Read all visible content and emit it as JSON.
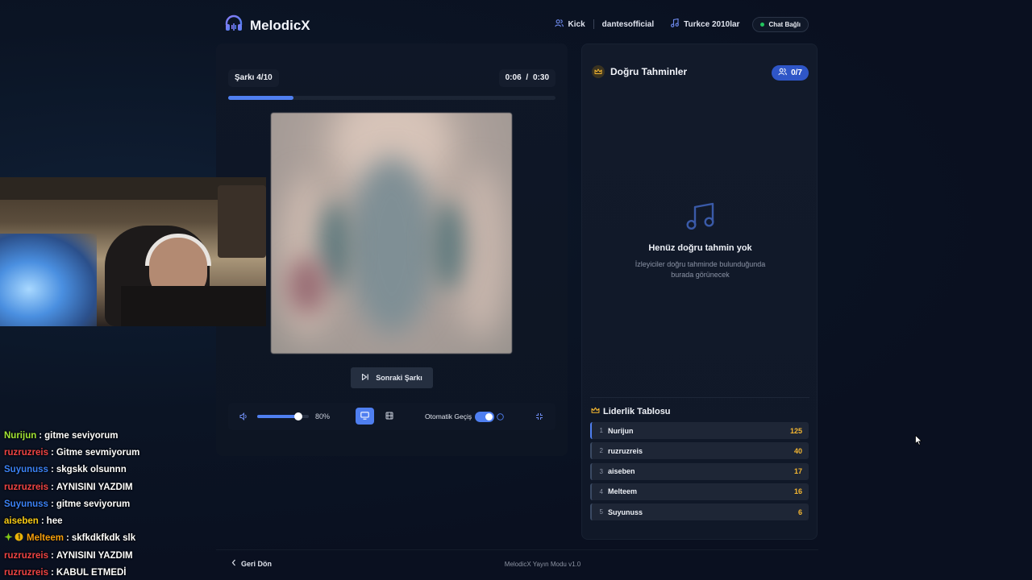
{
  "app": {
    "name": "MelodicX",
    "version_text": "MelodicX Yayın Modu v1.0",
    "colors": {
      "accent": "#4f7ff0",
      "success": "#22c55e",
      "gold": "#f5b731"
    }
  },
  "header": {
    "platform": "Kick",
    "channel": "dantesofficial",
    "playlist": "Turkce 2010lar",
    "chat_status": "Chat Bağlı"
  },
  "player": {
    "song_counter": "Şarkı 4/10",
    "time_current": "0:06",
    "time_separator": "/",
    "time_total": "0:30",
    "progress": 0.2,
    "next_label": "Sonraki Şarkı",
    "volume_label": "80%",
    "volume": 0.8,
    "auto_label": "Otomatik Geçiş",
    "auto_enabled": true
  },
  "guesses": {
    "title": "Doğru Tahminler",
    "count": "0/7",
    "empty_title": "Henüz doğru tahmin yok",
    "empty_desc_line1": "İzleyiciler doğru tahminde bulunduğunda",
    "empty_desc_line2": "burada görünecek"
  },
  "leaderboard": {
    "title": "Liderlik Tablosu",
    "rows": [
      {
        "rank": "1",
        "name": "Nurijun",
        "score": "125"
      },
      {
        "rank": "2",
        "name": "ruzruzreis",
        "score": "40"
      },
      {
        "rank": "3",
        "name": "aiseben",
        "score": "17"
      },
      {
        "rank": "4",
        "name": "Melteem",
        "score": "16"
      },
      {
        "rank": "5",
        "name": "Suyunuss",
        "score": "6"
      }
    ]
  },
  "chat_messages": [
    {
      "user": "Nurijun",
      "color": "#a3e635",
      "text": "gitme seviyorum"
    },
    {
      "user": "ruzruzreis",
      "color": "#ef4444",
      "text": "Gitme sevmiyorum"
    },
    {
      "user": "Suyunuss",
      "color": "#3b82f6",
      "text": "skgskk olsunnn"
    },
    {
      "user": "ruzruzreis",
      "color": "#ef4444",
      "text": "AYNISINI YAZDIM"
    },
    {
      "user": "Suyunuss",
      "color": "#3b82f6",
      "text": "gitme seviyorum"
    },
    {
      "user": "aiseben",
      "color": "#facc15",
      "text": "hee"
    },
    {
      "user": "Melteem",
      "color": "#f59e0b",
      "text": "skfkdkfkdk slk",
      "badges": true
    },
    {
      "user": "ruzruzreis",
      "color": "#ef4444",
      "text": "AYNISINI YAZDIM"
    },
    {
      "user": "ruzruzreis",
      "color": "#ef4444",
      "text": "KABUL ETMEDİ"
    }
  ],
  "footer": {
    "back_label": "Geri Dön"
  }
}
